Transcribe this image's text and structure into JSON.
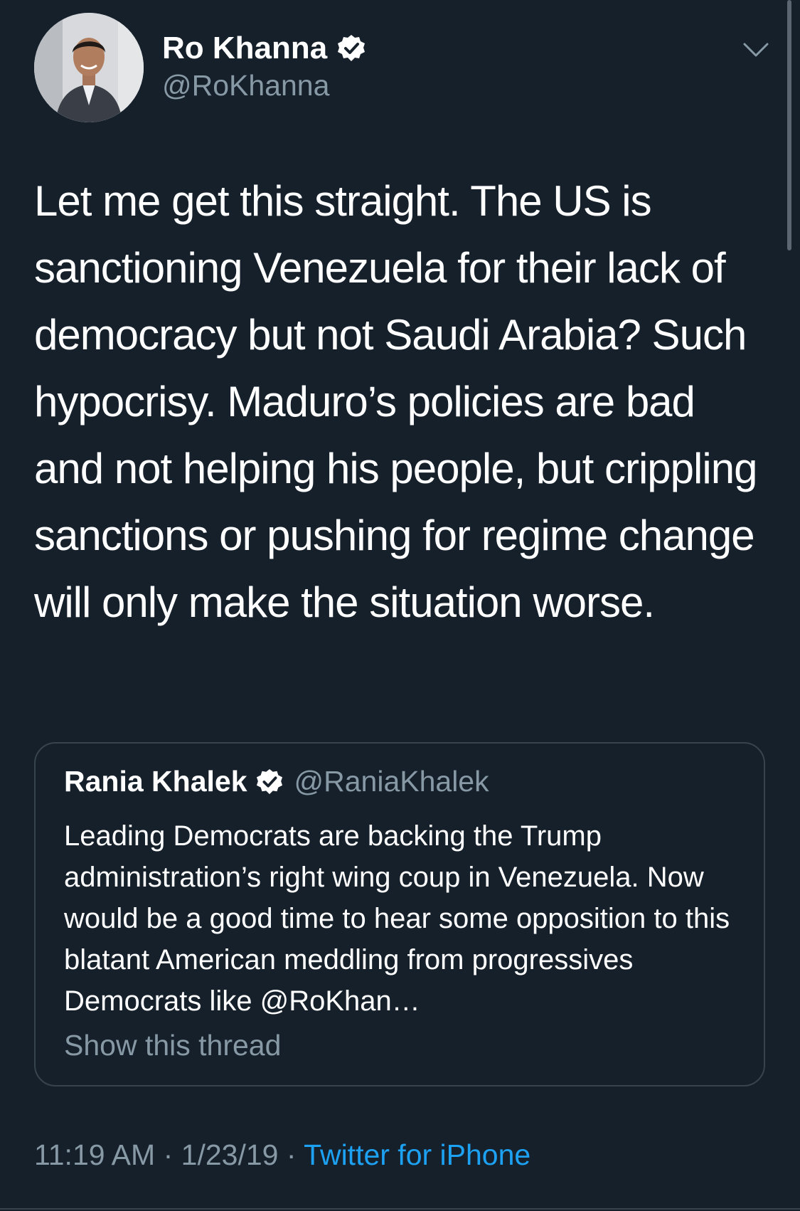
{
  "author": {
    "name": "Ro Khanna",
    "handle": "@RoKhanna",
    "verified": true,
    "avatar_icon": "profile-photo"
  },
  "tweet": {
    "text": "Let me get this straight. The US is sanctioning Venezuela for their lack of democracy but not Saudi Arabia? Such hypocrisy. Maduro’s policies are bad and not helping his people, but crippling sanctions or pushing for regime change will only make the situation worse."
  },
  "quoted_tweet": {
    "name": "Rania Khalek",
    "handle": "@RaniaKhalek",
    "verified": true,
    "text": "Leading Democrats are backing the Trump administration’s right wing coup in Venezuela. Now would be a good time to hear some opposition to this blatant American meddling from progressives Democrats like @RoKhan…",
    "show_thread_label": "Show this thread"
  },
  "meta": {
    "time": "11:19 AM",
    "separator": "·",
    "date": "1/23/19",
    "source": "Twitter for iPhone"
  },
  "colors": {
    "background": "#15202b",
    "secondary_text": "#8899a6",
    "accent": "#1da1f2",
    "border": "#38444d"
  },
  "icons": {
    "verified": "verified-badge-icon",
    "menu": "chevron-down-icon"
  }
}
